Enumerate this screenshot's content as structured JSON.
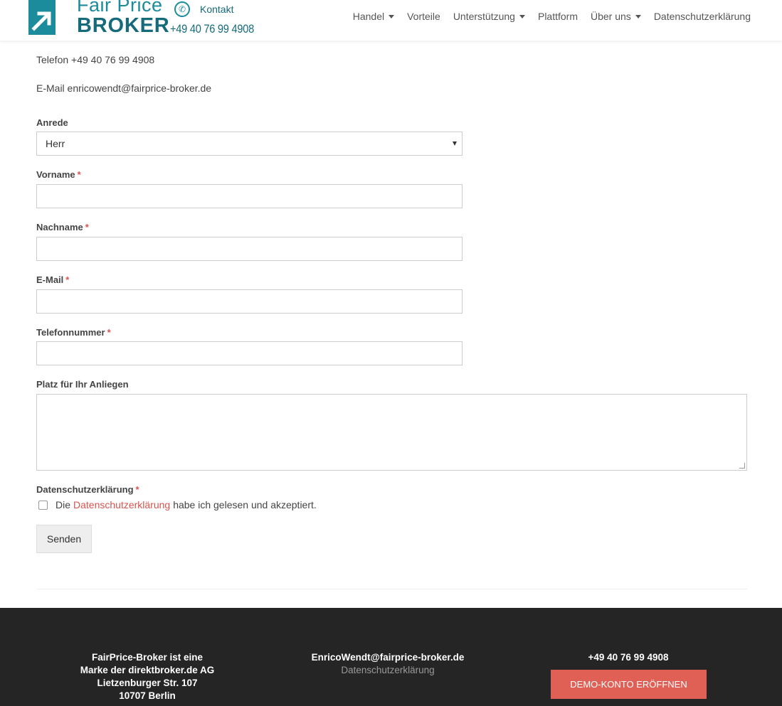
{
  "header": {
    "logo": {
      "line1": "Fair Price",
      "line2": "BROKER"
    },
    "contact": {
      "label": "Kontakt",
      "phone": "+49 40 76 99 4908"
    },
    "nav": [
      {
        "label": "Handel",
        "dropdown": true
      },
      {
        "label": "Vorteile",
        "dropdown": false
      },
      {
        "label": "Unterstützung",
        "dropdown": true
      },
      {
        "label": "Plattform",
        "dropdown": false
      },
      {
        "label": "Über uns",
        "dropdown": true
      },
      {
        "label": "Datenschutzerklärung",
        "dropdown": false
      }
    ]
  },
  "contact_info": {
    "telefon": "Telefon +49 40 76 99 4908",
    "email": "E-Mail enricowendt@fairprice-broker.de"
  },
  "form": {
    "anrede_label": "Anrede",
    "anrede_value": "Herr",
    "vorname_label": "Vorname",
    "nachname_label": "Nachname",
    "email_label": "E-Mail",
    "telefon_label": "Telefonnummer",
    "anliegen_label": "Platz für Ihr Anliegen",
    "privacy_label": "Datenschutzerklärung",
    "privacy_text_before": "Die",
    "privacy_link": "Datenschutzerklärung",
    "privacy_text_after": "habe ich gelesen und akzeptiert.",
    "required_marker": "*",
    "submit_label": "Senden"
  },
  "footer": {
    "company": [
      "FairPrice-Broker ist eine",
      "Marke der direktbroker.de AG",
      "Lietzenburger Str. 107",
      "10707 Berlin"
    ],
    "email": "EnricoWendt@fairprice-broker.de",
    "privacy": "Datenschutzerklärung",
    "phone": "+49 40 76 99 4908",
    "demo_button": "DEMO-KONTO ERÖFFNEN"
  },
  "colors": {
    "brand_teal": "#1b8c9c",
    "accent_red": "#e06056",
    "footer_bg": "#252525"
  }
}
